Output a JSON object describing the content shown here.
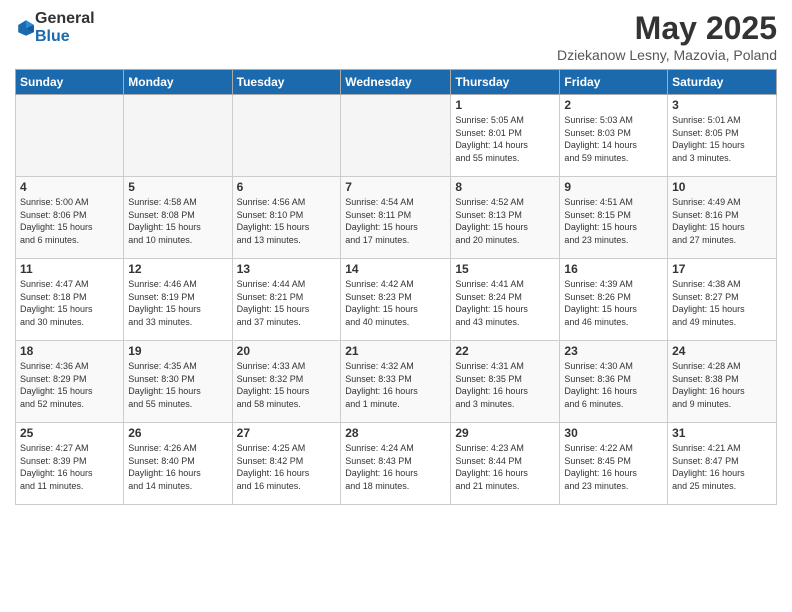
{
  "logo": {
    "general": "General",
    "blue": "Blue"
  },
  "header": {
    "month": "May 2025",
    "location": "Dziekanow Lesny, Mazovia, Poland"
  },
  "weekdays": [
    "Sunday",
    "Monday",
    "Tuesday",
    "Wednesday",
    "Thursday",
    "Friday",
    "Saturday"
  ],
  "weeks": [
    [
      {
        "day": "",
        "info": ""
      },
      {
        "day": "",
        "info": ""
      },
      {
        "day": "",
        "info": ""
      },
      {
        "day": "",
        "info": ""
      },
      {
        "day": "1",
        "info": "Sunrise: 5:05 AM\nSunset: 8:01 PM\nDaylight: 14 hours\nand 55 minutes."
      },
      {
        "day": "2",
        "info": "Sunrise: 5:03 AM\nSunset: 8:03 PM\nDaylight: 14 hours\nand 59 minutes."
      },
      {
        "day": "3",
        "info": "Sunrise: 5:01 AM\nSunset: 8:05 PM\nDaylight: 15 hours\nand 3 minutes."
      }
    ],
    [
      {
        "day": "4",
        "info": "Sunrise: 5:00 AM\nSunset: 8:06 PM\nDaylight: 15 hours\nand 6 minutes."
      },
      {
        "day": "5",
        "info": "Sunrise: 4:58 AM\nSunset: 8:08 PM\nDaylight: 15 hours\nand 10 minutes."
      },
      {
        "day": "6",
        "info": "Sunrise: 4:56 AM\nSunset: 8:10 PM\nDaylight: 15 hours\nand 13 minutes."
      },
      {
        "day": "7",
        "info": "Sunrise: 4:54 AM\nSunset: 8:11 PM\nDaylight: 15 hours\nand 17 minutes."
      },
      {
        "day": "8",
        "info": "Sunrise: 4:52 AM\nSunset: 8:13 PM\nDaylight: 15 hours\nand 20 minutes."
      },
      {
        "day": "9",
        "info": "Sunrise: 4:51 AM\nSunset: 8:15 PM\nDaylight: 15 hours\nand 23 minutes."
      },
      {
        "day": "10",
        "info": "Sunrise: 4:49 AM\nSunset: 8:16 PM\nDaylight: 15 hours\nand 27 minutes."
      }
    ],
    [
      {
        "day": "11",
        "info": "Sunrise: 4:47 AM\nSunset: 8:18 PM\nDaylight: 15 hours\nand 30 minutes."
      },
      {
        "day": "12",
        "info": "Sunrise: 4:46 AM\nSunset: 8:19 PM\nDaylight: 15 hours\nand 33 minutes."
      },
      {
        "day": "13",
        "info": "Sunrise: 4:44 AM\nSunset: 8:21 PM\nDaylight: 15 hours\nand 37 minutes."
      },
      {
        "day": "14",
        "info": "Sunrise: 4:42 AM\nSunset: 8:23 PM\nDaylight: 15 hours\nand 40 minutes."
      },
      {
        "day": "15",
        "info": "Sunrise: 4:41 AM\nSunset: 8:24 PM\nDaylight: 15 hours\nand 43 minutes."
      },
      {
        "day": "16",
        "info": "Sunrise: 4:39 AM\nSunset: 8:26 PM\nDaylight: 15 hours\nand 46 minutes."
      },
      {
        "day": "17",
        "info": "Sunrise: 4:38 AM\nSunset: 8:27 PM\nDaylight: 15 hours\nand 49 minutes."
      }
    ],
    [
      {
        "day": "18",
        "info": "Sunrise: 4:36 AM\nSunset: 8:29 PM\nDaylight: 15 hours\nand 52 minutes."
      },
      {
        "day": "19",
        "info": "Sunrise: 4:35 AM\nSunset: 8:30 PM\nDaylight: 15 hours\nand 55 minutes."
      },
      {
        "day": "20",
        "info": "Sunrise: 4:33 AM\nSunset: 8:32 PM\nDaylight: 15 hours\nand 58 minutes."
      },
      {
        "day": "21",
        "info": "Sunrise: 4:32 AM\nSunset: 8:33 PM\nDaylight: 16 hours\nand 1 minute."
      },
      {
        "day": "22",
        "info": "Sunrise: 4:31 AM\nSunset: 8:35 PM\nDaylight: 16 hours\nand 3 minutes."
      },
      {
        "day": "23",
        "info": "Sunrise: 4:30 AM\nSunset: 8:36 PM\nDaylight: 16 hours\nand 6 minutes."
      },
      {
        "day": "24",
        "info": "Sunrise: 4:28 AM\nSunset: 8:38 PM\nDaylight: 16 hours\nand 9 minutes."
      }
    ],
    [
      {
        "day": "25",
        "info": "Sunrise: 4:27 AM\nSunset: 8:39 PM\nDaylight: 16 hours\nand 11 minutes."
      },
      {
        "day": "26",
        "info": "Sunrise: 4:26 AM\nSunset: 8:40 PM\nDaylight: 16 hours\nand 14 minutes."
      },
      {
        "day": "27",
        "info": "Sunrise: 4:25 AM\nSunset: 8:42 PM\nDaylight: 16 hours\nand 16 minutes."
      },
      {
        "day": "28",
        "info": "Sunrise: 4:24 AM\nSunset: 8:43 PM\nDaylight: 16 hours\nand 18 minutes."
      },
      {
        "day": "29",
        "info": "Sunrise: 4:23 AM\nSunset: 8:44 PM\nDaylight: 16 hours\nand 21 minutes."
      },
      {
        "day": "30",
        "info": "Sunrise: 4:22 AM\nSunset: 8:45 PM\nDaylight: 16 hours\nand 23 minutes."
      },
      {
        "day": "31",
        "info": "Sunrise: 4:21 AM\nSunset: 8:47 PM\nDaylight: 16 hours\nand 25 minutes."
      }
    ]
  ]
}
